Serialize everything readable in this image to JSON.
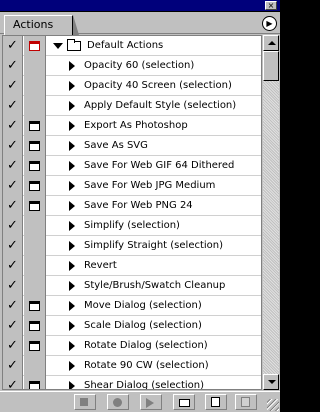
{
  "palette": {
    "tab_label": "Actions",
    "close_glyph": "×",
    "menu_glyph": "▶"
  },
  "check_glyph": "✓",
  "folder": {
    "label": "Default Actions",
    "dialog": "red"
  },
  "actions": [
    {
      "label": "Opacity 60 (selection)",
      "dialog": "none"
    },
    {
      "label": "Opacity 40 Screen (selection)",
      "dialog": "none"
    },
    {
      "label": "Apply Default Style (selection)",
      "dialog": "none"
    },
    {
      "label": "Export As Photoshop",
      "dialog": "on"
    },
    {
      "label": "Save As SVG",
      "dialog": "on"
    },
    {
      "label": "Save For Web GIF 64 Dithered",
      "dialog": "on"
    },
    {
      "label": "Save For Web JPG Medium",
      "dialog": "on"
    },
    {
      "label": "Save For Web PNG 24",
      "dialog": "on"
    },
    {
      "label": "Simplify (selection)",
      "dialog": "empty"
    },
    {
      "label": "Simplify Straight (selection)",
      "dialog": "empty"
    },
    {
      "label": "Revert",
      "dialog": "none"
    },
    {
      "label": "Style/Brush/Swatch Cleanup",
      "dialog": "empty"
    },
    {
      "label": "Move Dialog (selection)",
      "dialog": "on"
    },
    {
      "label": "Scale Dialog (selection)",
      "dialog": "on"
    },
    {
      "label": "Rotate Dialog (selection)",
      "dialog": "on"
    },
    {
      "label": "Rotate 90 CW (selection)",
      "dialog": "none"
    },
    {
      "label": "Shear Dialog (selection)",
      "dialog": "on"
    }
  ],
  "toolbar": {
    "buttons": [
      "stop-icon",
      "record-icon",
      "play-icon",
      "new-set-icon",
      "new-action-icon",
      "trash-icon"
    ]
  }
}
